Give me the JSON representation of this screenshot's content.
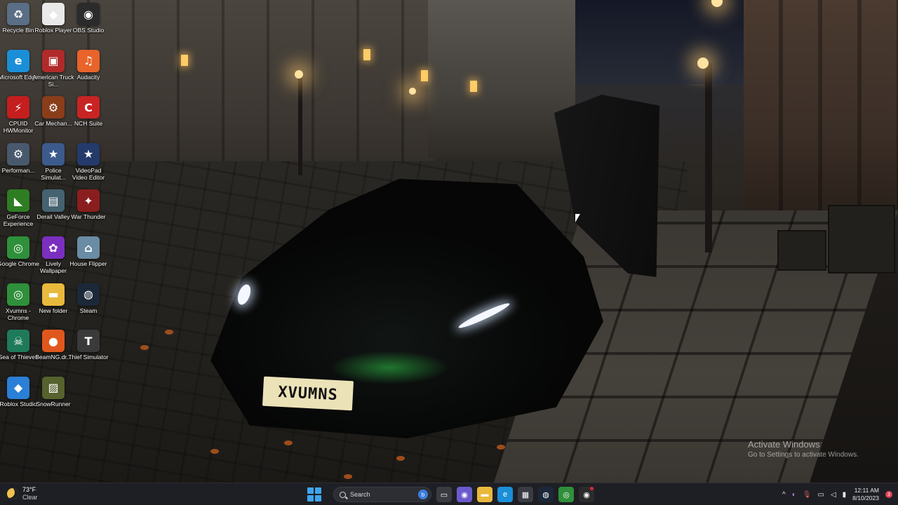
{
  "desktop": {
    "icons": [
      {
        "label": "Recycle Bin",
        "glyph": "♻",
        "color": "#5a6e86"
      },
      {
        "label": "Roblox Player",
        "glyph": "◆",
        "color": "#e9e9e9"
      },
      {
        "label": "OBS Studio",
        "glyph": "◉",
        "color": "#2b2b2b"
      },
      {
        "label": "Microsoft Edge",
        "glyph": "e",
        "color": "#1a8fd8"
      },
      {
        "label": "American Truck Si...",
        "glyph": "▣",
        "color": "#b02a2a"
      },
      {
        "label": "Audacity",
        "glyph": "♫",
        "color": "#e8642a"
      },
      {
        "label": "CPUID HWMonitor",
        "glyph": "⚡",
        "color": "#c41e1e"
      },
      {
        "label": "Car Mechan...",
        "glyph": "⚙",
        "color": "#8a3d1a"
      },
      {
        "label": "NCH Suite",
        "glyph": "C",
        "color": "#c82424"
      },
      {
        "label": "Performan...",
        "glyph": "⚙",
        "color": "#49596d"
      },
      {
        "label": "Police Simulat...",
        "glyph": "★",
        "color": "#3c5a8c"
      },
      {
        "label": "VideoPad Video Editor",
        "glyph": "★",
        "color": "#243a6a"
      },
      {
        "label": "GeForce Experience",
        "glyph": "◣",
        "color": "#2e7d23"
      },
      {
        "label": "Derail Valley",
        "glyph": "▤",
        "color": "#456270"
      },
      {
        "label": "War Thunder",
        "glyph": "✦",
        "color": "#8a1e1e"
      },
      {
        "label": "Google Chrome",
        "glyph": "◎",
        "color": "#2f8f3a"
      },
      {
        "label": "Lively Wallpaper",
        "glyph": "✿",
        "color": "#7b2fbf"
      },
      {
        "label": "House Flipper",
        "glyph": "⌂",
        "color": "#6a8ca4"
      },
      {
        "label": "Xvumns - Chrome",
        "glyph": "◎",
        "color": "#2f8f3a"
      },
      {
        "label": "New folder",
        "glyph": "▬",
        "color": "#e9b93c"
      },
      {
        "label": "Steam",
        "glyph": "◍",
        "color": "#1b2838"
      },
      {
        "label": "Sea of Thieves",
        "glyph": "☠",
        "color": "#1e7a5a"
      },
      {
        "label": "BeamNG.dr...",
        "glyph": "●",
        "color": "#e0571d"
      },
      {
        "label": "Thief Simulator",
        "glyph": "T",
        "color": "#3a3a3a"
      },
      {
        "label": "Roblox Studio",
        "glyph": "◆",
        "color": "#2a7fd6"
      },
      {
        "label": "SnowRunner",
        "glyph": "▨",
        "color": "#56622e"
      }
    ]
  },
  "wallpaper": {
    "plate_text": "XVUMNS"
  },
  "watermark": {
    "title": "Activate Windows",
    "subtitle": "Go to Settings to activate Windows."
  },
  "taskbar": {
    "weather": {
      "temp": "73°F",
      "condition": "Clear",
      "icon": "moon-icon"
    },
    "search": {
      "placeholder": "Search",
      "bing_glyph": "b"
    },
    "apps": [
      {
        "name": "task-view",
        "glyph": "▭",
        "color": "#3a3b42"
      },
      {
        "name": "chat",
        "glyph": "◉",
        "color": "#6a5acd"
      },
      {
        "name": "file-explorer",
        "glyph": "▬",
        "color": "#e9b93c"
      },
      {
        "name": "edge",
        "glyph": "e",
        "color": "#1a8fd8"
      },
      {
        "name": "store",
        "glyph": "▦",
        "color": "#3a3b42"
      },
      {
        "name": "steam",
        "glyph": "◍",
        "color": "#1b2838"
      },
      {
        "name": "chrome",
        "glyph": "◎",
        "color": "#2f8f3a"
      },
      {
        "name": "obs",
        "glyph": "◉",
        "color": "#2b2b2b"
      }
    ],
    "tray": {
      "chevron": "^",
      "time": "12:11 AM",
      "date": "8/10/2023",
      "notification_count": "3"
    }
  }
}
